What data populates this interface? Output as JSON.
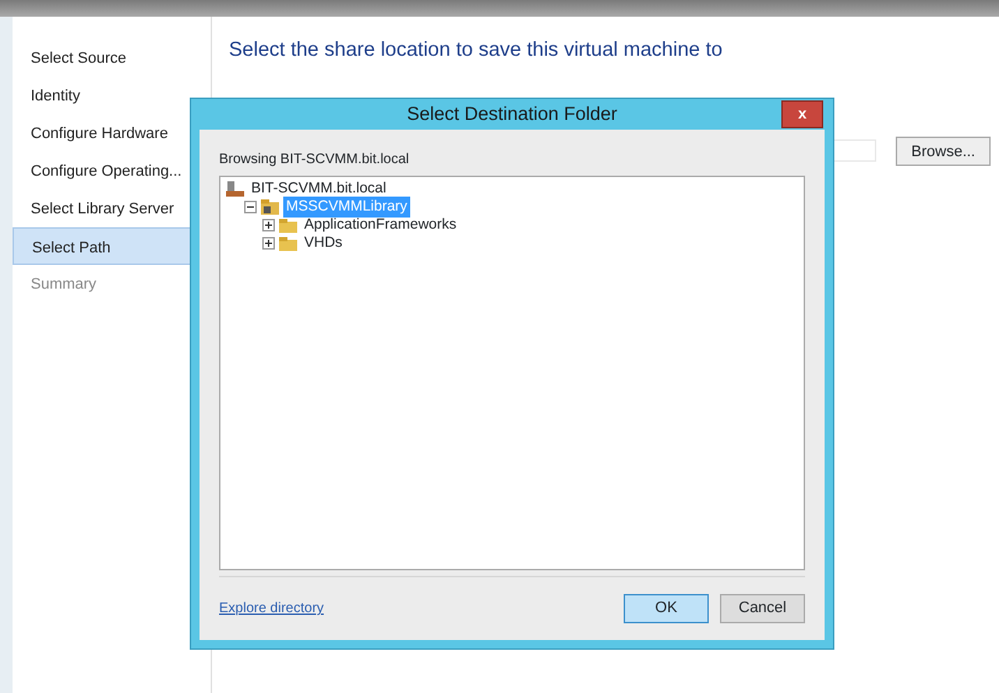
{
  "wizard_steps": [
    {
      "label": "Select Source",
      "selected": false,
      "disabled": false
    },
    {
      "label": "Identity",
      "selected": false,
      "disabled": false
    },
    {
      "label": "Configure Hardware",
      "selected": false,
      "disabled": false
    },
    {
      "label": "Configure Operating...",
      "selected": false,
      "disabled": false
    },
    {
      "label": "Select Library Server",
      "selected": false,
      "disabled": false
    },
    {
      "label": "Select Path",
      "selected": true,
      "disabled": false
    },
    {
      "label": "Summary",
      "selected": false,
      "disabled": true
    }
  ],
  "heading": "Select the share location to save this virtual machine to",
  "browse_button": "Browse...",
  "dialog": {
    "title": "Select Destination Folder",
    "close": "x",
    "browsing_label": "Browsing BIT-SCVMM.bit.local",
    "tree": [
      {
        "label": "BIT-SCVMM.bit.local",
        "kind": "server",
        "selected": false,
        "children": [
          {
            "label": "MSSCVMMLibrary",
            "kind": "share",
            "selected": true,
            "expanded": true,
            "children": [
              {
                "label": "ApplicationFrameworks",
                "kind": "folder",
                "selected": false,
                "expanded": false
              },
              {
                "label": "VHDs",
                "kind": "folder",
                "selected": false,
                "expanded": false
              }
            ]
          }
        ]
      }
    ],
    "link": "Explore directory",
    "buttons": [
      {
        "label": "OK",
        "focused": true
      },
      {
        "label": "Cancel",
        "focused": false
      }
    ]
  }
}
